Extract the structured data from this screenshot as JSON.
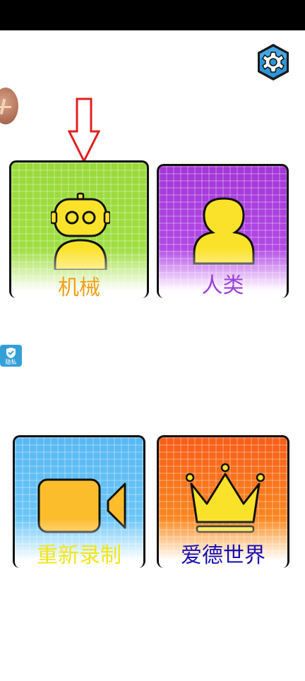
{
  "header": {
    "settings_icon": "gear-icon"
  },
  "profile": {
    "avatar_icon": "avatar-image"
  },
  "hint": {
    "arrow_color": "#e02020"
  },
  "privacy": {
    "label": "隐私",
    "icon": "shield-icon"
  },
  "modes": [
    {
      "label": "机械",
      "icon": "robot-icon",
      "label_color": "#f0a21a"
    },
    {
      "label": "人类",
      "icon": "person-icon",
      "label_color": "#9b3fd6"
    },
    {
      "label": "重新录制",
      "icon": "video-camera-icon",
      "label_color": "#f2e51e"
    },
    {
      "label": "爱德世界",
      "icon": "crown-icon",
      "label_color": "#1a10b5"
    }
  ]
}
